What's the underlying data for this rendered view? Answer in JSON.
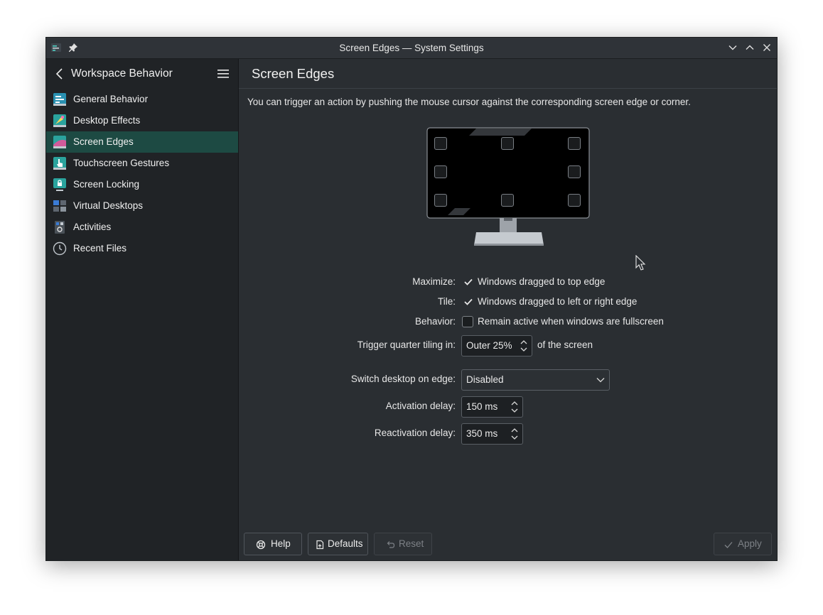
{
  "window": {
    "title": "Screen Edges — System Settings"
  },
  "sidebar": {
    "title": "Workspace Behavior",
    "items": [
      {
        "label": "General Behavior",
        "icon": "general-behavior-icon"
      },
      {
        "label": "Desktop Effects",
        "icon": "desktop-effects-icon"
      },
      {
        "label": "Screen Edges",
        "icon": "screen-edges-icon",
        "active": true
      },
      {
        "label": "Touchscreen Gestures",
        "icon": "touchscreen-gestures-icon"
      },
      {
        "label": "Screen Locking",
        "icon": "screen-locking-icon"
      },
      {
        "label": "Virtual Desktops",
        "icon": "virtual-desktops-icon"
      },
      {
        "label": "Activities",
        "icon": "activities-icon"
      },
      {
        "label": "Recent Files",
        "icon": "recent-files-icon"
      }
    ]
  },
  "page": {
    "title": "Screen Edges",
    "intro": "You can trigger an action by pushing the mouse cursor against the corresponding screen edge or corner."
  },
  "form": {
    "maximize": {
      "label": "Maximize:",
      "text": "Windows dragged to top edge",
      "checked": true
    },
    "tile": {
      "label": "Tile:",
      "text": "Windows dragged to left or right edge",
      "checked": true
    },
    "behavior": {
      "label": "Behavior:",
      "text": "Remain active when windows are fullscreen",
      "checked": false
    },
    "quarter": {
      "label": "Trigger quarter tiling in:",
      "value": "Outer 25%",
      "suffix": "of the screen"
    },
    "switch_desktop": {
      "label": "Switch desktop on edge:",
      "value": "Disabled"
    },
    "activation_delay": {
      "label": "Activation delay:",
      "value": "150 ms"
    },
    "reactivation_delay": {
      "label": "Reactivation delay:",
      "value": "350 ms"
    }
  },
  "footer": {
    "help": "Help",
    "defaults": "Defaults",
    "reset": "Reset",
    "apply": "Apply"
  },
  "colors": {
    "window_bg": "#2a2e32",
    "sidebar_bg": "#202326",
    "selection": "#1d4a43",
    "text": "#fcfcfc"
  }
}
